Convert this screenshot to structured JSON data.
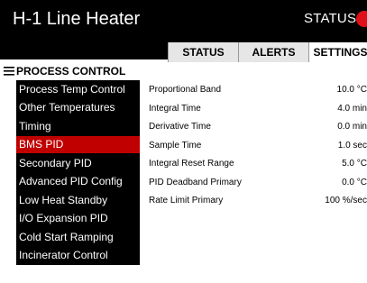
{
  "header": {
    "title": "H-1 Line Heater",
    "status_label": "STATUS",
    "status_color": "#e0101a"
  },
  "tabs": [
    {
      "label": "STATUS",
      "active": false
    },
    {
      "label": "ALERTS",
      "active": false
    },
    {
      "label": "SETTINGS",
      "active": true
    }
  ],
  "section": {
    "title": "PROCESS CONTROL",
    "icon": "menu-lines-icon"
  },
  "menu": {
    "items": [
      {
        "label": "Process Temp Control",
        "active": false
      },
      {
        "label": "Other Temperatures",
        "active": false
      },
      {
        "label": "Timing",
        "active": false
      },
      {
        "label": "BMS PID",
        "active": true
      },
      {
        "label": "Secondary PID",
        "active": false
      },
      {
        "label": "Advanced PID Config",
        "active": false
      },
      {
        "label": "Low Heat Standby",
        "active": false
      },
      {
        "label": "I/O Expansion PID",
        "active": false
      },
      {
        "label": "Cold Start Ramping",
        "active": false
      },
      {
        "label": "Incinerator Control",
        "active": false
      }
    ],
    "active_color": "#c00000"
  },
  "params": [
    {
      "name": "Proportional Band",
      "value": "10.0 °C"
    },
    {
      "name": "Integral Time",
      "value": "4.0 min"
    },
    {
      "name": "Derivative Time",
      "value": "0.0 min"
    },
    {
      "name": "Sample Time",
      "value": "1.0 sec"
    },
    {
      "name": "Integral Reset Range",
      "value": "5.0 °C"
    },
    {
      "name": "PID Deadband Primary",
      "value": "0.0 °C"
    },
    {
      "name": "Rate Limit Primary",
      "value": "100 %/sec"
    }
  ]
}
